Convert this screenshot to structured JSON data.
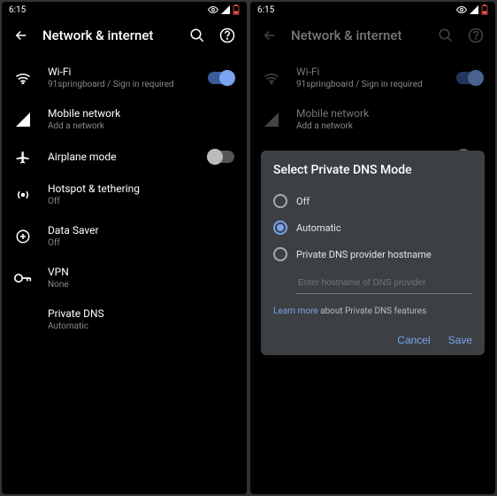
{
  "statusbar": {
    "time": "6:15"
  },
  "header": {
    "title": "Network & internet"
  },
  "rows": {
    "wifi": {
      "label": "Wi-Fi",
      "sub": "91springboard / Sign in required"
    },
    "mobile": {
      "label": "Mobile network",
      "sub": "Add a network"
    },
    "airplane": {
      "label": "Airplane mode"
    },
    "hotspot": {
      "label": "Hotspot & tethering",
      "sub": "Off"
    },
    "datasaver": {
      "label": "Data Saver",
      "sub": "Off"
    },
    "vpn": {
      "label": "VPN",
      "sub": "None"
    },
    "pdns": {
      "label": "Private DNS",
      "sub": "Automatic"
    }
  },
  "dialog": {
    "title": "Select Private DNS Mode",
    "options": {
      "off": "Off",
      "auto": "Automatic",
      "host": "Private DNS provider hostname"
    },
    "placeholder": "Enter hostname of DNS provider",
    "learn_link": "Learn more",
    "learn_rest": " about Private DNS features",
    "cancel": "Cancel",
    "save": "Save"
  }
}
